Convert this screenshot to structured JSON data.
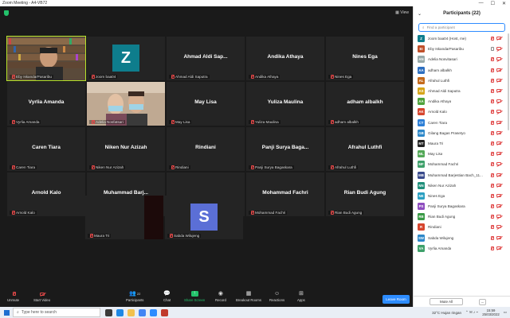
{
  "window": {
    "title": "Zoom Meeting - A4-VB72",
    "controls": [
      "—",
      "☐",
      "✕"
    ]
  },
  "topbar": {
    "view_label": "View"
  },
  "grid_tiles": [
    {
      "label": "Eby IskandarPasaribu",
      "bigname": "",
      "kind": "video-man",
      "active": true
    },
    {
      "label": "zoom baa04",
      "bigname": "",
      "kind": "avatar",
      "letter": "Z"
    },
    {
      "label": "Ahmad Aldi Saputra",
      "bigname": "Ahmad Aldi Sap..."
    },
    {
      "label": "Andika Athaya",
      "bigname": "Andika Athaya"
    },
    {
      "label": "Nines Ega",
      "bigname": "Nines Ega"
    },
    {
      "label": "Vyrlia Amanda",
      "bigname": "Vyrlia Amanda"
    },
    {
      "label": "Adelia Nosfatsari",
      "bigname": "",
      "kind": "video-women"
    },
    {
      "label": "May Lisa",
      "bigname": "May Lisa"
    },
    {
      "label": "Yuliza Maulina",
      "bigname": "Yuliza Maulina"
    },
    {
      "label": "adham albalkh",
      "bigname": "adham albalkh"
    },
    {
      "label": "Caren Tiara",
      "bigname": "Caren Tiara"
    },
    {
      "label": "Niken Nur Azizah",
      "bigname": "Niken Nur Azizah"
    },
    {
      "label": "Rindiani",
      "bigname": "Rindiani"
    },
    {
      "label": "Panji Surya Bagaskara",
      "bigname": "Panji Surya Baga..."
    },
    {
      "label": "Afrahul Luthfi",
      "bigname": "Afrahul Luthfi"
    },
    {
      "label": "Arnold Kalo",
      "bigname": "Arnold Kalo"
    },
    {
      "label": "Muhammad Barjestian Bach_11820206",
      "bigname": "Muhammad Barj..."
    },
    {
      "label": "Gilang Bagas Prasetyo",
      "bigname": ""
    },
    {
      "label": "Mohammad Fachri",
      "bigname": "Mohammad Fachri"
    },
    {
      "label": "Rian Budi Agung",
      "bigname": "Rian Budi Agung"
    }
  ],
  "last_row": [
    {
      "label": "Maura Tri",
      "kind": "dark"
    },
    {
      "label": "Sabda Wilujeng",
      "kind": "avatar",
      "letter": "S"
    }
  ],
  "toolbar": {
    "unmute": "Unmute",
    "start_video": "Start Video",
    "participants": "Participants",
    "participants_count": "22",
    "chat": "Chat",
    "share_screen": "Share Screen",
    "record": "Record",
    "breakout_rooms": "Breakout Rooms",
    "reactions": "Reactions",
    "apps": "Apps",
    "leave_room": "Leave Room"
  },
  "panel": {
    "title": "Participants (22)",
    "search_placeholder": "Find a participant",
    "mute_all": "Mute All",
    "more": "...",
    "participants": [
      {
        "initials": "Z",
        "name": "zoom baa04 (Host, me)",
        "color": "#0e7d8c",
        "mic_on": false
      },
      {
        "initials": "EI",
        "name": "Eby IskandarPasaribu",
        "color": "#c0502a",
        "mic_on": true,
        "photo": true
      },
      {
        "initials": "AN",
        "name": "Adelia Nosvitasari",
        "color": "#9aa",
        "mic_on": false,
        "photo": true
      },
      {
        "initials": "AA",
        "name": "adham albalkh",
        "color": "#2d6fc0",
        "mic_on": false
      },
      {
        "initials": "AL",
        "name": "Afrahul Luthfi",
        "color": "#c46a1c",
        "mic_on": false
      },
      {
        "initials": "AS",
        "name": "Ahmad Aldi Saputra",
        "color": "#d6a51a",
        "mic_on": false
      },
      {
        "initials": "AA",
        "name": "Andika Athaya",
        "color": "#4fa23c",
        "mic_on": false
      },
      {
        "initials": "AK",
        "name": "Arnold Kalo",
        "color": "#d6452e",
        "mic_on": false
      },
      {
        "initials": "CT",
        "name": "Caren Tiara",
        "color": "#2b7ed6",
        "mic_on": false
      },
      {
        "initials": "GB",
        "name": "Gilang Bagas Prasetyo",
        "color": "#2d88c9",
        "mic_on": false
      },
      {
        "initials": "MT",
        "name": "Maura Tri",
        "color": "#222",
        "mic_on": false
      },
      {
        "initials": "ML",
        "name": "May Lisa",
        "color": "#53a857",
        "mic_on": false
      },
      {
        "initials": "MF",
        "name": "Mohammad Fachri",
        "color": "#3ea06a",
        "mic_on": false
      },
      {
        "initials": "MB",
        "name": "Muhammad Barjestian Bach_11...",
        "color": "#3a4b8c",
        "mic_on": false
      },
      {
        "initials": "NN",
        "name": "Niken Nur Azizah",
        "color": "#1f8f7a",
        "mic_on": false
      },
      {
        "initials": "NE",
        "name": "Nines Ega",
        "color": "#2a9fc1",
        "mic_on": false
      },
      {
        "initials": "PS",
        "name": "Panji Surya Bagaskara",
        "color": "#8e4dbf",
        "mic_on": false
      },
      {
        "initials": "RB",
        "name": "Rian Budi Agung",
        "color": "#3a9a46",
        "mic_on": false
      },
      {
        "initials": "R",
        "name": "Rindiani",
        "color": "#d6452e",
        "mic_on": false
      },
      {
        "initials": "SW",
        "name": "Sabda Wilujeng",
        "color": "#2d88c9",
        "mic_on": false
      },
      {
        "initials": "VA",
        "name": "Vyrlia Amanda",
        "color": "#3ea06a",
        "mic_on": false
      }
    ]
  },
  "taskbar": {
    "search_placeholder": "Type here to search",
    "weather": "32°C  Hujan ringan",
    "time": "15:59",
    "date": "25/03/2022"
  },
  "colors": {
    "accent": "#2d8cff",
    "share_green": "#23c26b",
    "active_speaker": "#b6e32b",
    "muted_red": "#e04848"
  }
}
